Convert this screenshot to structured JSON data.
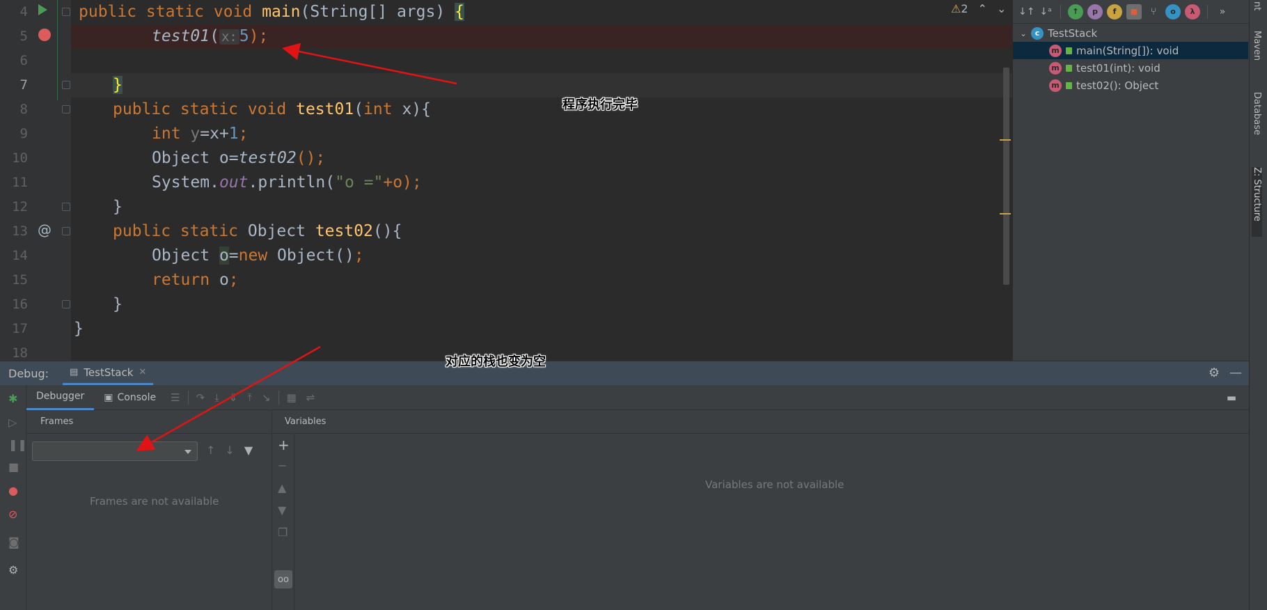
{
  "editor": {
    "warning_count": "2",
    "lines": [
      {
        "num": "4"
      },
      {
        "num": "5"
      },
      {
        "num": "6"
      },
      {
        "num": "7"
      },
      {
        "num": "8"
      },
      {
        "num": "9"
      },
      {
        "num": "10"
      },
      {
        "num": "11"
      },
      {
        "num": "12"
      },
      {
        "num": "13"
      },
      {
        "num": "14"
      },
      {
        "num": "15"
      },
      {
        "num": "16"
      },
      {
        "num": "17"
      },
      {
        "num": "18"
      }
    ],
    "code": {
      "l4_kw": "public static void ",
      "l4_fn": "main",
      "l4_rest": "(String[] args) ",
      "l4_brace": "{",
      "l5_call": "test01",
      "l5_open": "(",
      "l5_hint": "x:",
      "l5_num": "5",
      "l5_close": ");",
      "l7_brace": "}",
      "l8_kw": "public static void ",
      "l8_fn": "test01",
      "l8_p1": "(",
      "l8_kw2": "int",
      "l8_rest": " x){",
      "l9_kw": "int ",
      "l9_var": "y",
      "l9_eq": "=x+",
      "l9_num": "1",
      "l9_semi": ";",
      "l10_a": "Object o=",
      "l10_call": "test02",
      "l10_b": "();",
      "l11_a": "System.",
      "l11_field": "out",
      "l11_b": ".println(",
      "l11_str": "\"o =\"",
      "l11_c": "+o);",
      "l12": "}",
      "l13_kw": "public static ",
      "l13_type": "Object ",
      "l13_fn": "test02",
      "l13_rest": "(){",
      "l14_a": "Object ",
      "l14_o": "o",
      "l14_eq": "=",
      "l14_new": "new ",
      "l14_b": "Object()",
      "l14_semi": ";",
      "l15_kw": "return ",
      "l15_b": "o",
      "l15_semi": ";",
      "l16": "}",
      "l17": "}"
    }
  },
  "annotations": {
    "program_done": "程序执行完毕",
    "stack_empty": "对应的栈也变为空"
  },
  "structure": {
    "class_name": "TestStack",
    "methods": [
      {
        "label": "main(String[]): void"
      },
      {
        "label": "test01(int): void"
      },
      {
        "label": "test02(): Object"
      }
    ]
  },
  "side_tabs": {
    "maven": "Maven",
    "database": "Database",
    "structure": "Z: Structure",
    "top": "nt"
  },
  "debug": {
    "label": "Debug:",
    "session_tab": "TestStack",
    "debugger_tab": "Debugger",
    "console_tab": "Console",
    "frames_title": "Frames",
    "frames_empty": "Frames are not available",
    "variables_title": "Variables",
    "variables_empty": "Variables are not available"
  },
  "colors": {
    "annotation_arrow": "#e01414",
    "breakpoint": "#db5c5c",
    "selection": "#0d293e",
    "accent_tab": "#4a88c7"
  }
}
